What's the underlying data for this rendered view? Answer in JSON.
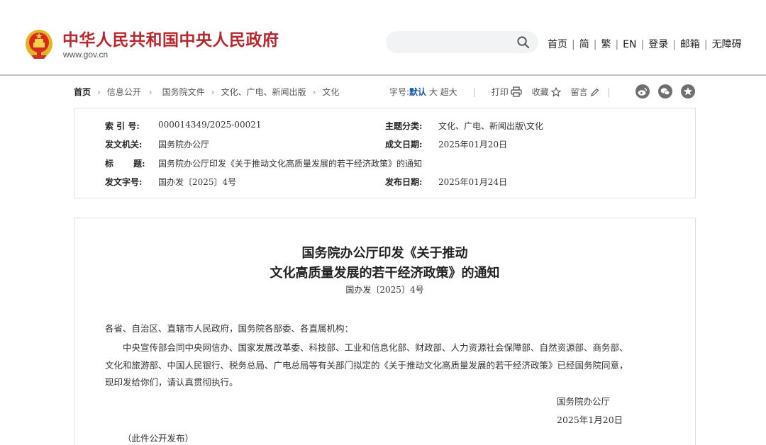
{
  "header": {
    "site_title": "中华人民共和国中央人民政府",
    "site_domain": "www.gov.cn",
    "search_placeholder": "",
    "nav_links": [
      "首页",
      "简",
      "繁",
      "EN",
      "登录",
      "邮箱",
      "无障碍"
    ]
  },
  "breadcrumb": [
    "首页",
    "信息公开",
    "国务院文件",
    "文化、广电、新闻出版",
    "文化"
  ],
  "toolbar": {
    "font_size_label": "字号:",
    "font_sizes": [
      "默认",
      "大",
      "超大"
    ],
    "selected_font_size": "默认",
    "print_label": "打印",
    "favorite_label": "收藏",
    "comment_label": "留言",
    "share_icons": [
      "weibo-icon",
      "wechat-icon",
      "star-share-icon"
    ]
  },
  "info": {
    "index_label": "索 引 号:",
    "index_value": "000014349/2025-00021",
    "category_label": "主题分类:",
    "category_value": "文化、广电、新闻出版\\文化",
    "issuer_label": "发文机关:",
    "issuer_value": "国务院办公厅",
    "created_label": "成文日期:",
    "created_value": "2025年01月20日",
    "title_label": "标 题:",
    "title_value": "国务院办公厅印发《关于推动文化高质量发展的若干经济政策》的通知",
    "docno_label": "发文字号:",
    "docno_value": "国办发〔2025〕4号",
    "published_label": "发布日期:",
    "published_value": "2025年01月24日"
  },
  "article": {
    "title_line1": "国务院办公厅印发《关于推动",
    "title_line2": "文化高质量发展的若干经济政策》的通知",
    "doc_number": "国办发〔2025〕4号",
    "salutation": "各省、自治区、直辖市人民政府，国务院各部委、各直属机构：",
    "body_line1": "中央宣传部会同中央网信办、国家发展改革委、科技部、工业和信息化部、财政部、人力资源社会保障部、自然资源部、商务部、",
    "body_line2": "文化和旅游部、中国人民银行、税务总局、广电总局等有关部门拟定的《关于推动文化高质量发展的若干经济政策》已经国务院同意，",
    "body_line3": "现印发给你们，请认真贯彻执行。",
    "signature": "国务院办公厅",
    "date": "2025年1月20日",
    "note": "（此件公开发布）"
  },
  "colors": {
    "brand_red": "#b7282e",
    "accent_blue": "#1a59a8",
    "border_gray": "#dfdfdf",
    "share_icon_gray": "#6f6f6f"
  }
}
